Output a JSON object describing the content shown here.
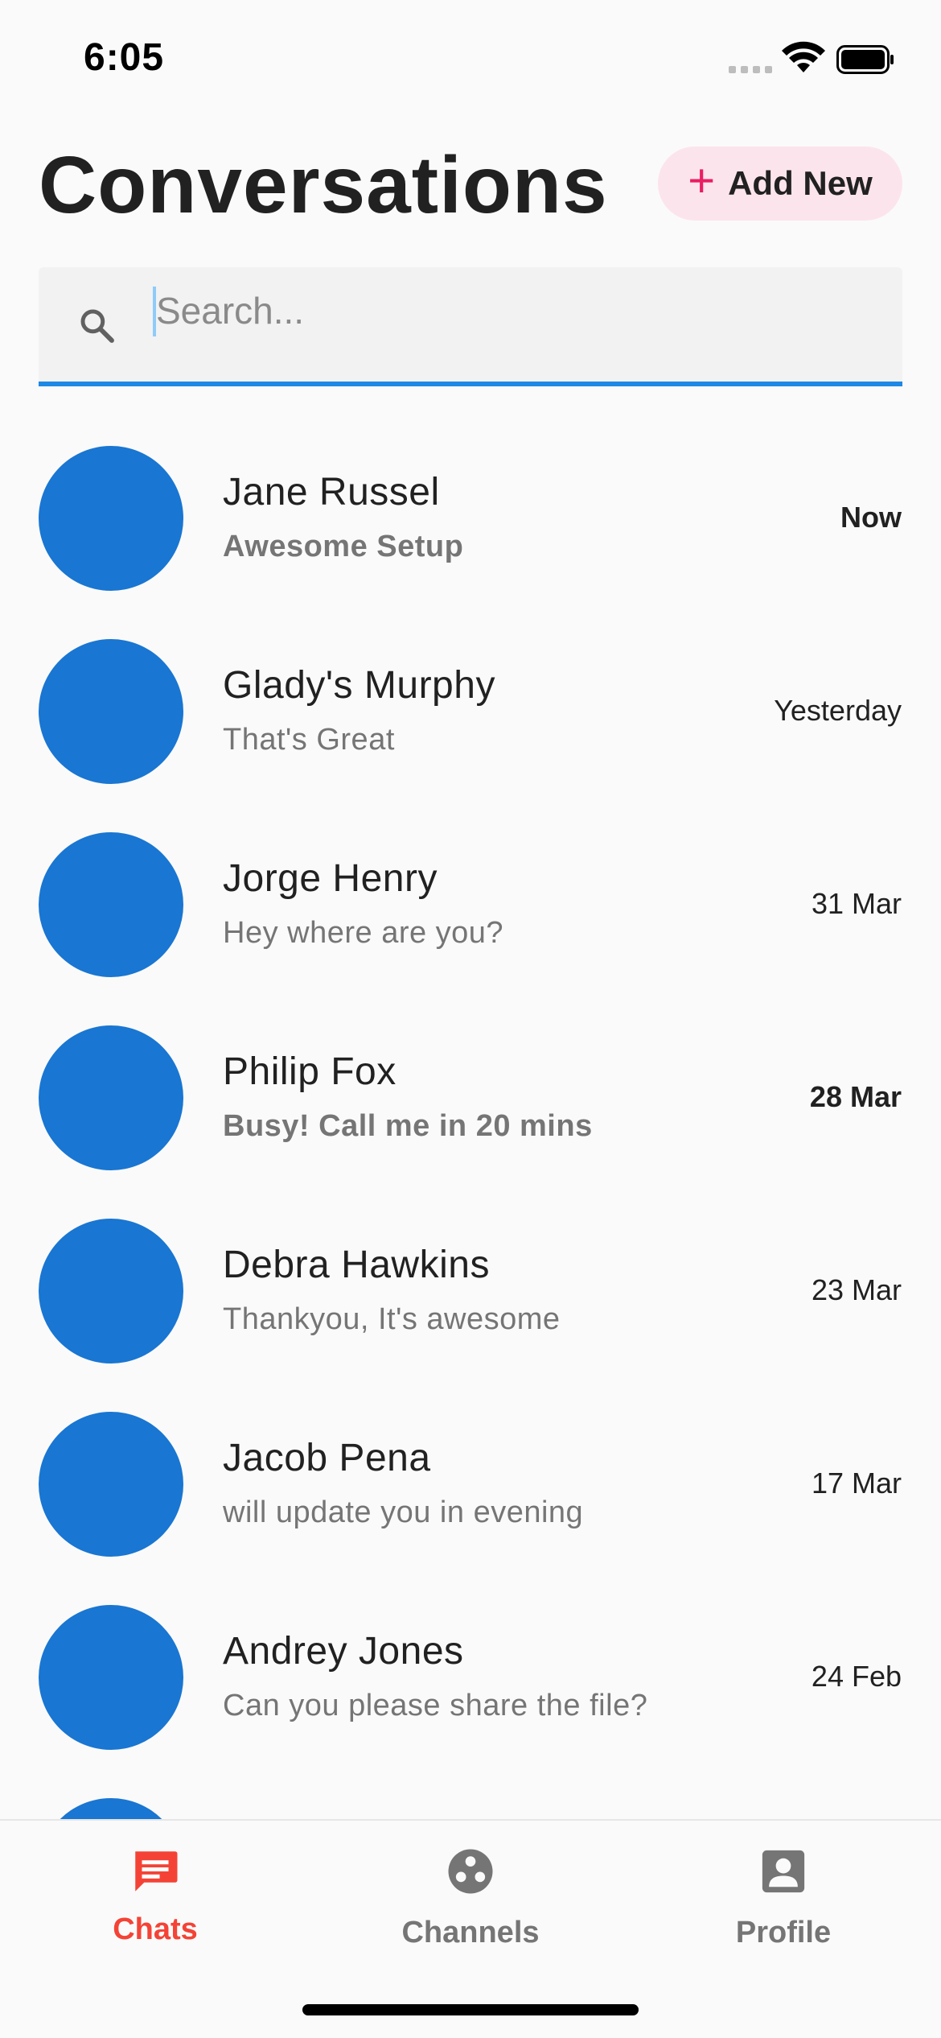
{
  "status_bar": {
    "time": "6:05"
  },
  "header": {
    "title": "Conversations",
    "add_new": {
      "icon": "plus-icon",
      "label": "Add New",
      "accent_color": "#e91e63",
      "background": "#fce4ec"
    }
  },
  "search": {
    "placeholder": "Search...",
    "value": "",
    "underline_color": "#1e88e5"
  },
  "avatar_color": "#1976d2",
  "chats": [
    {
      "name": "Jane Russel",
      "message": "Awesome Setup",
      "time": "Now",
      "unread": true
    },
    {
      "name": "Glady's Murphy",
      "message": "That's Great",
      "time": "Yesterday",
      "unread": false
    },
    {
      "name": "Jorge Henry",
      "message": "Hey where are you?",
      "time": "31 Mar",
      "unread": false
    },
    {
      "name": "Philip Fox",
      "message": "Busy! Call me in 20 mins",
      "time": "28 Mar",
      "unread": true
    },
    {
      "name": "Debra Hawkins",
      "message": "Thankyou, It's awesome",
      "time": "23 Mar",
      "unread": false
    },
    {
      "name": "Jacob Pena",
      "message": "will update you in evening",
      "time": "17 Mar",
      "unread": false
    },
    {
      "name": "Andrey Jones",
      "message": "Can you please share the file?",
      "time": "24 Feb",
      "unread": false
    }
  ],
  "bottom_nav": {
    "active_color": "#f44336",
    "items": [
      {
        "label": "Chats",
        "icon": "chat-icon",
        "active": true
      },
      {
        "label": "Channels",
        "icon": "channels-icon",
        "active": false
      },
      {
        "label": "Profile",
        "icon": "profile-icon",
        "active": false
      }
    ]
  }
}
